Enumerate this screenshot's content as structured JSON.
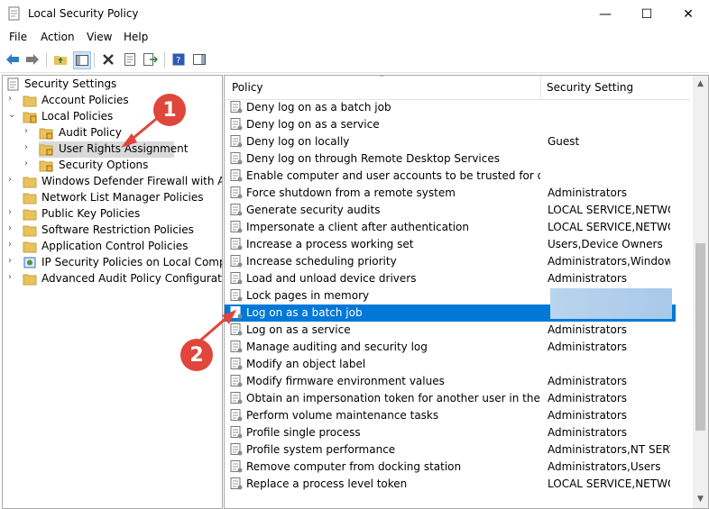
{
  "window": {
    "title": "Local Security Policy",
    "minimize_glyph": "—",
    "maximize_glyph": "☐",
    "close_glyph": "✕"
  },
  "menu": [
    "File",
    "Action",
    "View",
    "Help"
  ],
  "tree": [
    {
      "label": "Security Settings",
      "indent": 0,
      "expander": "",
      "icon": "security-settings-icon"
    },
    {
      "label": "Account Policies",
      "indent": 1,
      "expander": "›",
      "icon": "folder-icon"
    },
    {
      "label": "Local Policies",
      "indent": 1,
      "expander": "⌄",
      "icon": "folder-open-icon"
    },
    {
      "label": "Audit Policy",
      "indent": 2,
      "expander": "›",
      "icon": "folder-icon"
    },
    {
      "label": "User Rights Assignment",
      "indent": 2,
      "expander": "›",
      "icon": "folder-open-icon",
      "selected": true
    },
    {
      "label": "Security Options",
      "indent": 2,
      "expander": "›",
      "icon": "folder-icon"
    },
    {
      "label": "Windows Defender Firewall with Adva",
      "indent": 1,
      "expander": "›",
      "icon": "folder-icon"
    },
    {
      "label": "Network List Manager Policies",
      "indent": 1,
      "expander": "",
      "icon": "folder-icon"
    },
    {
      "label": "Public Key Policies",
      "indent": 1,
      "expander": "›",
      "icon": "folder-icon"
    },
    {
      "label": "Software Restriction Policies",
      "indent": 1,
      "expander": "›",
      "icon": "folder-icon"
    },
    {
      "label": "Application Control Policies",
      "indent": 1,
      "expander": "›",
      "icon": "folder-icon"
    },
    {
      "label": "IP Security Policies on Local Compute",
      "indent": 1,
      "expander": "›",
      "icon": "ip-security-icon"
    },
    {
      "label": "Advanced Audit Policy Configuration",
      "indent": 1,
      "expander": "›",
      "icon": "folder-icon"
    }
  ],
  "list": {
    "columns": [
      "Policy",
      "Security Setting"
    ],
    "rows": [
      {
        "policy": "Deny log on as a batch job",
        "setting": ""
      },
      {
        "policy": "Deny log on as a service",
        "setting": ""
      },
      {
        "policy": "Deny log on locally",
        "setting": "Guest"
      },
      {
        "policy": "Deny log on through Remote Desktop Services",
        "setting": ""
      },
      {
        "policy": "Enable computer and user accounts to be trusted for delega...",
        "setting": ""
      },
      {
        "policy": "Force shutdown from a remote system",
        "setting": "Administrators"
      },
      {
        "policy": "Generate security audits",
        "setting": "LOCAL SERVICE,NETWO..."
      },
      {
        "policy": "Impersonate a client after authentication",
        "setting": "LOCAL SERVICE,NETWO..."
      },
      {
        "policy": "Increase a process working set",
        "setting": "Users,Device Owners"
      },
      {
        "policy": "Increase scheduling priority",
        "setting": "Administrators,Window ..."
      },
      {
        "policy": "Load and unload device drivers",
        "setting": "Administrators"
      },
      {
        "policy": "Lock pages in memory",
        "setting": ""
      },
      {
        "policy": "Log on as a batch job",
        "setting": "",
        "selected": true
      },
      {
        "policy": "Log on as a service",
        "setting": "Administrators"
      },
      {
        "policy": "Manage auditing and security log",
        "setting": "Administrators"
      },
      {
        "policy": "Modify an object label",
        "setting": ""
      },
      {
        "policy": "Modify firmware environment values",
        "setting": "Administrators"
      },
      {
        "policy": "Obtain an impersonation token for another user in the same...",
        "setting": "Administrators"
      },
      {
        "policy": "Perform volume maintenance tasks",
        "setting": "Administrators"
      },
      {
        "policy": "Profile single process",
        "setting": "Administrators"
      },
      {
        "policy": "Profile system performance",
        "setting": "Administrators,NT SERVI..."
      },
      {
        "policy": "Remove computer from docking station",
        "setting": "Administrators,Users"
      },
      {
        "policy": "Replace a process level token",
        "setting": "LOCAL SERVICE,NETWO..."
      }
    ]
  },
  "callouts": [
    "1",
    "2"
  ],
  "colors": {
    "selection": "#0078d7",
    "tree_selection": "#d9d9d9",
    "callout": "#e0463b"
  }
}
